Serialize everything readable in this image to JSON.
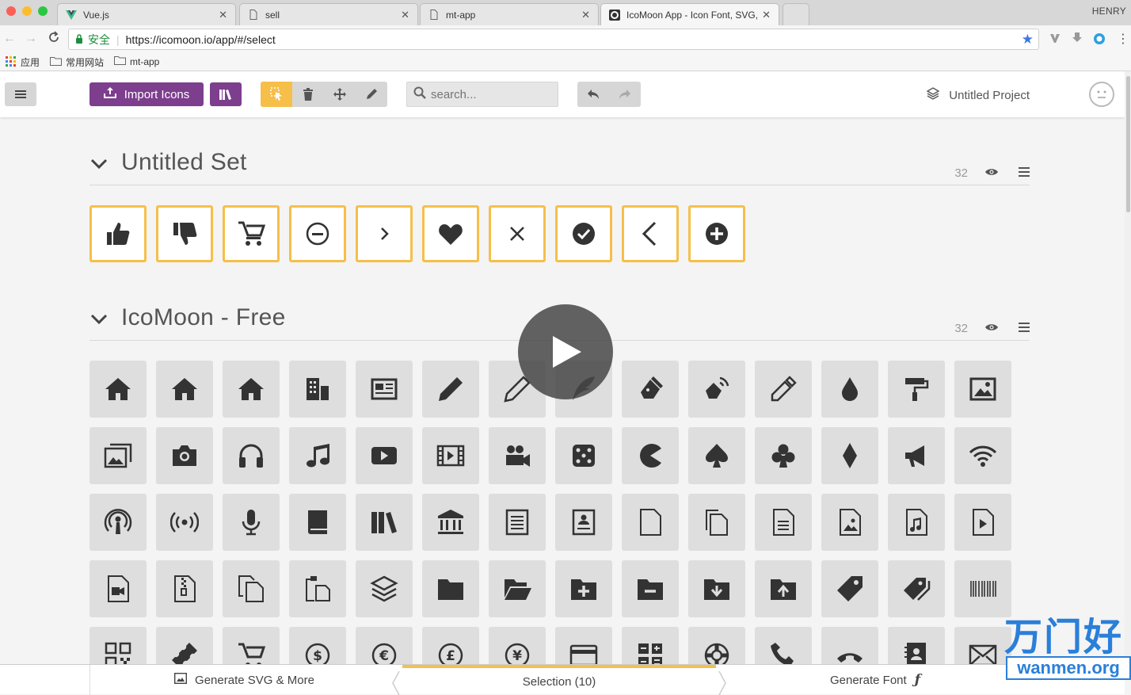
{
  "browser": {
    "tabs": [
      {
        "title": "Vue.js",
        "icon": "vue-logo-icon"
      },
      {
        "title": "sell",
        "icon": "document-icon"
      },
      {
        "title": "mt-app",
        "icon": "document-icon"
      },
      {
        "title": "IcoMoon App - Icon Font, SVG,",
        "icon": "icomoon-logo-icon"
      }
    ],
    "profile": "HENRY",
    "secure_label": "安全",
    "url": "https://icomoon.io/app/#/select",
    "bookmarks": [
      {
        "label": "应用",
        "icon": "apps-grid-icon"
      },
      {
        "label": "常用网站",
        "icon": "folder-icon"
      },
      {
        "label": "mt-app",
        "icon": "folder-icon"
      }
    ]
  },
  "app": {
    "import_label": "Import Icons",
    "search_placeholder": "search...",
    "project_name": "Untitled Project",
    "accent_color": "#7d3e8e",
    "selection_color": "#f6bf4a"
  },
  "sets": [
    {
      "title": "Untitled Set",
      "count": "32"
    },
    {
      "title": "IcoMoon - Free",
      "count": "32"
    }
  ],
  "selected_icons": [
    "thumbs-up-icon",
    "thumbs-down-icon",
    "cart-icon",
    "minus-circle-icon",
    "chevron-right-icon",
    "heart-icon",
    "close-icon",
    "check-circle-icon",
    "chevron-left-icon",
    "plus-circle-icon"
  ],
  "free_icons": [
    [
      "home-icon",
      "home2-icon",
      "home3-icon",
      "office-icon",
      "newspaper-icon",
      "pencil-icon",
      "pencil2-icon",
      "quill-icon",
      "pen-icon",
      "blog-icon",
      "eyedropper-icon",
      "droplet-icon",
      "paint-format-icon",
      "image-icon"
    ],
    [
      "images-icon",
      "camera-icon",
      "headphones-icon",
      "music-icon",
      "play-icon",
      "film-icon",
      "video-camera-icon",
      "dice-icon",
      "pacman-icon",
      "spades-icon",
      "clubs-icon",
      "diamonds-icon",
      "bullhorn-icon",
      "connection-icon"
    ],
    [
      "podcast-icon",
      "feed-icon",
      "mic-icon",
      "book-icon",
      "books-icon",
      "library-icon",
      "file-text-icon",
      "profile-icon",
      "file-empty-icon",
      "files-empty-icon",
      "file-text2-icon",
      "file-picture-icon",
      "file-music-icon",
      "file-play-icon"
    ],
    [
      "file-video-icon",
      "file-zip-icon",
      "copy-icon",
      "paste-icon",
      "stack-icon",
      "folder-icon",
      "folder-open-icon",
      "folder-plus-icon",
      "folder-minus-icon",
      "folder-download-icon",
      "folder-upload-icon",
      "price-tag-icon",
      "price-tags-icon",
      "barcode-icon"
    ],
    [
      "qrcode-icon",
      "ticket-icon",
      "cart2-icon",
      "coin-dollar-icon",
      "coin-euro-icon",
      "coin-pound-icon",
      "coin-yen-icon",
      "credit-card-icon",
      "calculator-icon",
      "lifebuoy-icon",
      "phone-icon",
      "phone-hang-up-icon",
      "address-book-icon",
      "envelop-icon"
    ]
  ],
  "footer": {
    "generate_svg": "Generate SVG & More",
    "selection": "Selection (10)",
    "generate_font": "Generate Font"
  },
  "watermark": {
    "cn": "万门好",
    "url": "wanmen.org"
  }
}
